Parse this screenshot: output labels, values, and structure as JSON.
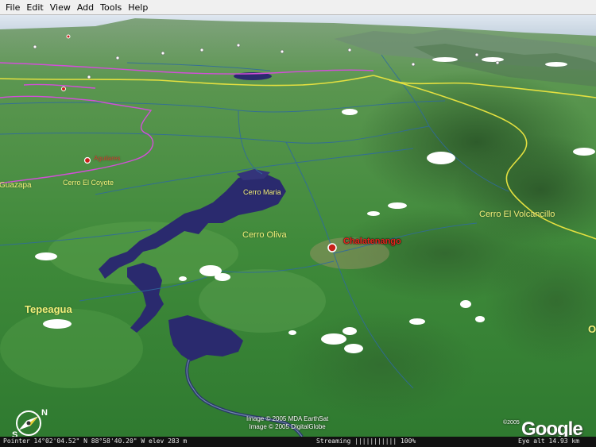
{
  "menu": [
    "File",
    "Edit",
    "View",
    "Add",
    "Tools",
    "Help"
  ],
  "labels": {
    "aguilares": "Aguilares",
    "cerro_el_coyote": "Cerro El Coyote",
    "guazapa": "Guazapa",
    "cerro_maria": "Cerro Maria",
    "cerro_oliva": "Cerro Oliva",
    "chalatenango": "Chalatenango",
    "cerro_el_volcancillo": "Cerro El Volcancillo",
    "tepeagua": "Tepeagua",
    "edge_o": "O"
  },
  "copyright": {
    "line1": "Image © 2005 MDA EarthSat",
    "line2": "Image © 2005 DigitalGlobe",
    "google_year": "©2005",
    "logo": "Google"
  },
  "compass": {
    "north": "N",
    "south": "S"
  },
  "status": {
    "pointer": "Pointer  14°02'04.52\" N   88°58'40.20\" W   elev  283 m",
    "streaming": "Streaming ||||||||||| 100%",
    "eye_alt": "Eye  alt   14.93 km"
  },
  "colors": {
    "terrain": "#3f8a3a",
    "water": "#2a2a6e",
    "road_yellow": "#e4e040",
    "border_magenta": "#d24fd8"
  }
}
